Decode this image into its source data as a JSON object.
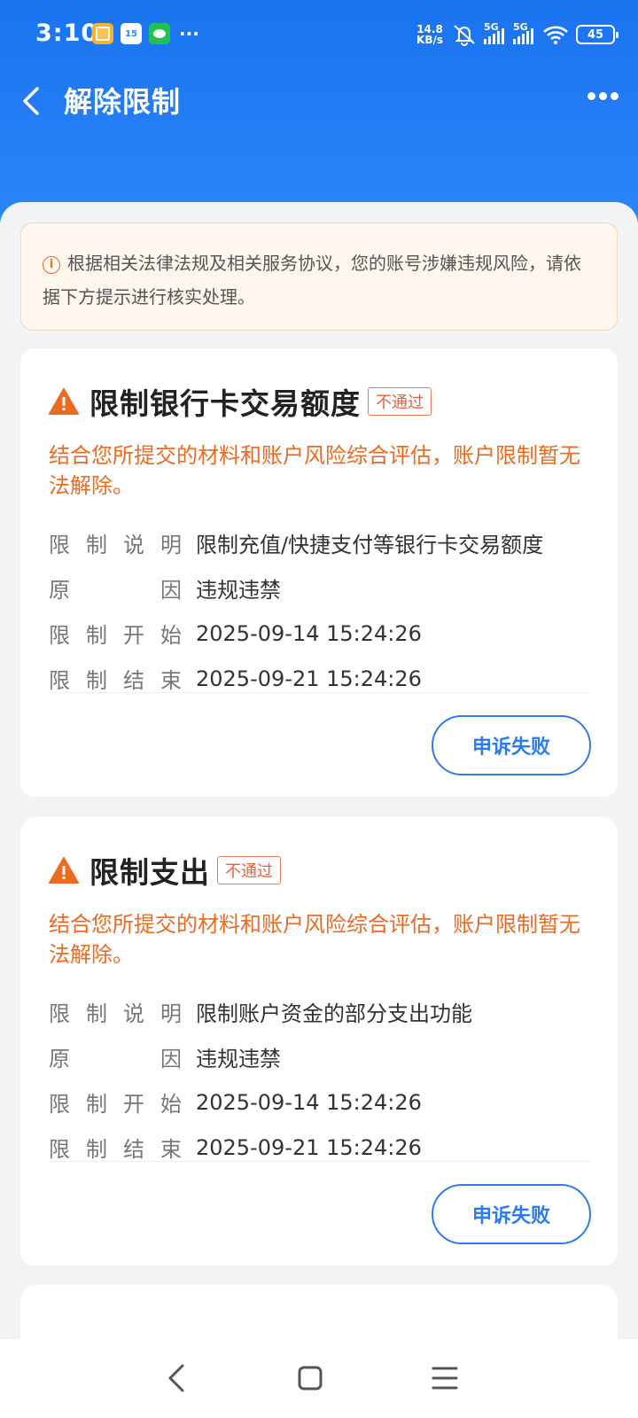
{
  "status_bar": {
    "time": "3:10",
    "calendar_day": "15",
    "more": "···",
    "net_speed_value": "14.8",
    "net_speed_unit": "KB/s",
    "sim1": "5G",
    "sim2": "5G",
    "battery": "45",
    "icons": [
      "notes-app-icon",
      "calendar-app-icon",
      "wechat-icon",
      "mute-icon",
      "signal-icon",
      "wifi-icon",
      "battery-icon"
    ]
  },
  "nav": {
    "title": "解除限制"
  },
  "notice": {
    "text": "根据相关法律法规及相关服务协议，您的账号涉嫌违规风险，请依据下方提示进行核实处理。"
  },
  "restrictions": [
    {
      "title": "限制银行卡交易额度",
      "status": "不通过",
      "message": "结合您所提交的材料和账户风险综合评估，账户限制暂无法解除。",
      "fields": [
        {
          "label": "限制说明",
          "value": "限制充值/快捷支付等银行卡交易额度"
        },
        {
          "label": "原因",
          "value": "违规违禁"
        },
        {
          "label": "限制开始",
          "value": "2025-09-14 15:24:26"
        },
        {
          "label": "限制结束",
          "value": "2025-09-21 15:24:26"
        }
      ],
      "button": "申诉失败"
    },
    {
      "title": "限制支出",
      "status": "不通过",
      "message": "结合您所提交的材料和账户风险综合评估，账户限制暂无法解除。",
      "fields": [
        {
          "label": "限制说明",
          "value": "限制账户资金的部分支出功能"
        },
        {
          "label": "原因",
          "value": "违规违禁"
        },
        {
          "label": "限制开始",
          "value": "2025-09-14 15:24:26"
        },
        {
          "label": "限制结束",
          "value": "2025-09-21 15:24:26"
        }
      ],
      "button": "申诉失败"
    }
  ],
  "colors": {
    "header": "#1a73f0",
    "warning": "#ed6a21",
    "button": "#2b7cf0"
  }
}
